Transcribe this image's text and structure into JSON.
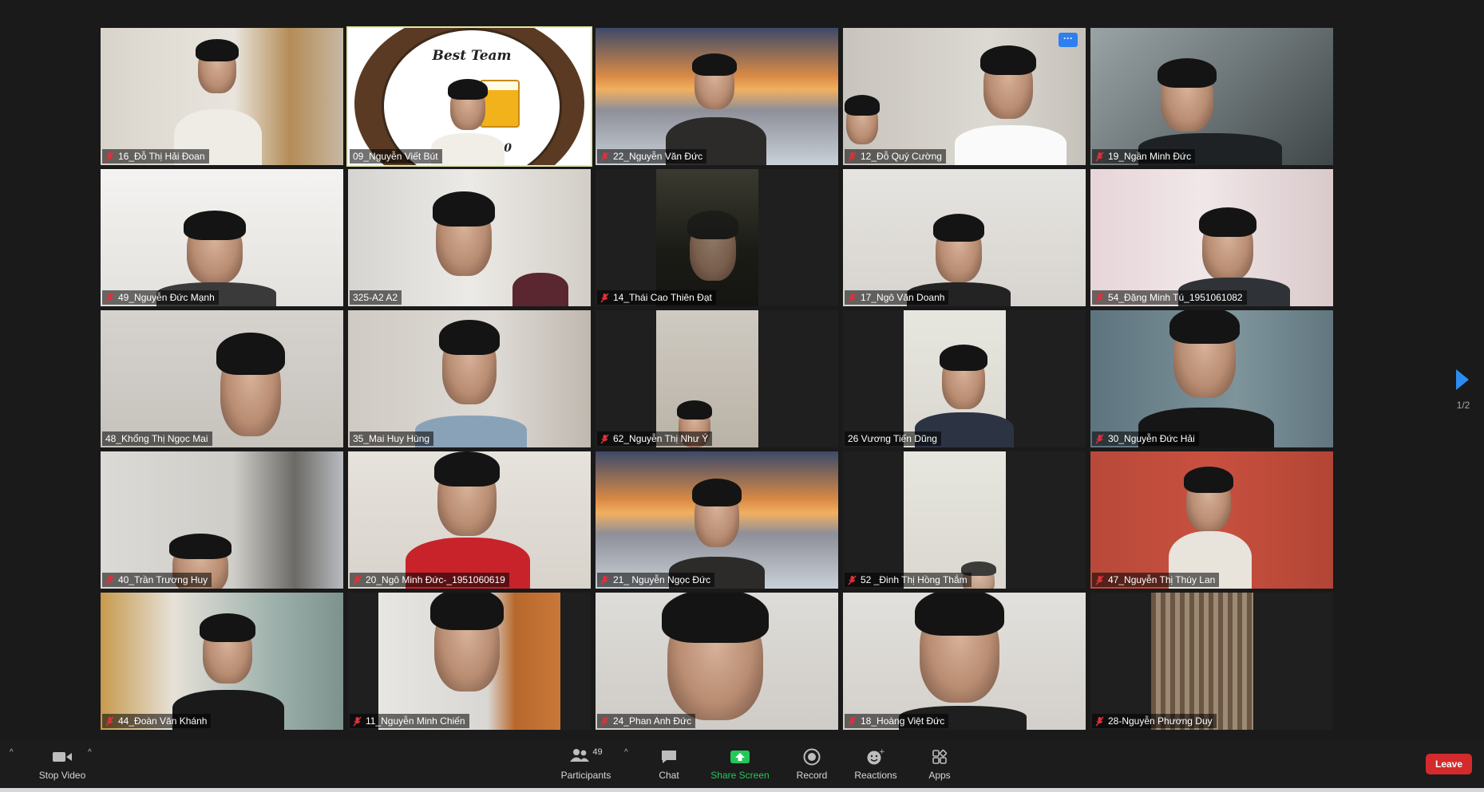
{
  "participants": [
    {
      "name": "16_Đỗ Thị Hải Đoan",
      "muted": true
    },
    {
      "name": "09_Nguyễn Viết Bút",
      "muted": false,
      "active_speaker": true
    },
    {
      "name": "22_Nguyễn Văn Đức",
      "muted": true
    },
    {
      "name": "12_Đỗ Quý Cường",
      "muted": true
    },
    {
      "name": "19_Ngần Minh Đức",
      "muted": true
    },
    {
      "name": "49_Nguyễn Đức Mạnh",
      "muted": true
    },
    {
      "name": "325-A2 A2",
      "muted": false
    },
    {
      "name": "14_Thái Cao Thiên Đạt",
      "muted": true
    },
    {
      "name": "17_Ngô Văn Doanh",
      "muted": true
    },
    {
      "name": "54_Đặng Minh Tú_1951061082",
      "muted": true
    },
    {
      "name": "48_Khổng Thị Ngọc Mai",
      "muted": false
    },
    {
      "name": "35_Mai Huy Hùng",
      "muted": false
    },
    {
      "name": "62_Nguyễn Thị Như Ý",
      "muted": true
    },
    {
      "name": "26 Vương Tiến Dũng",
      "muted": false
    },
    {
      "name": "30_Nguyễn Đức Hải",
      "muted": true
    },
    {
      "name": "40_Trần Trương Huy",
      "muted": true
    },
    {
      "name": "20_Ngô Minh Đức-_1951060619",
      "muted": true
    },
    {
      "name": "21_ Nguyễn Ngọc Đức",
      "muted": true
    },
    {
      "name": "52 _Đinh Thị Hồng Thắm",
      "muted": true
    },
    {
      "name": "47_Nguyễn Thị Thúy Lan",
      "muted": true
    },
    {
      "name": "44_Đoàn Văn Khánh",
      "muted": true
    },
    {
      "name": "11_Nguyễn Minh Chiến",
      "muted": true
    },
    {
      "name": "24_Phan Anh Đức",
      "muted": true
    },
    {
      "name": "18_Hoàng Việt Đức",
      "muted": true
    },
    {
      "name": "28-Nguyễn Phương Duy",
      "muted": true
    }
  ],
  "badge": {
    "title": "Best Team",
    "year": "2020"
  },
  "pagination": {
    "label": "1/2"
  },
  "toolbar": {
    "stop_video": "Stop Video",
    "participants": "Participants",
    "participant_count": "49",
    "chat": "Chat",
    "share_screen": "Share Screen",
    "record": "Record",
    "reactions": "Reactions",
    "apps": "Apps",
    "leave": "Leave"
  },
  "colors": {
    "background": "#1a1a1a",
    "active_speaker_border": "#e5e8a0",
    "share_screen_green": "#25c75b",
    "leave_red": "#d32b2b",
    "muted_mic_red": "#e0303a",
    "nav_arrow": "#2d8cf0"
  },
  "icons": {
    "muted_mic": "mic-off-icon",
    "video": "video-camera-icon",
    "participants": "people-icon",
    "chat": "chat-bubble-icon",
    "share": "share-arrow-icon",
    "record": "record-icon",
    "reactions": "emoji-plus-icon",
    "apps": "apps-grid-icon",
    "next": "next-page-arrow-icon"
  }
}
